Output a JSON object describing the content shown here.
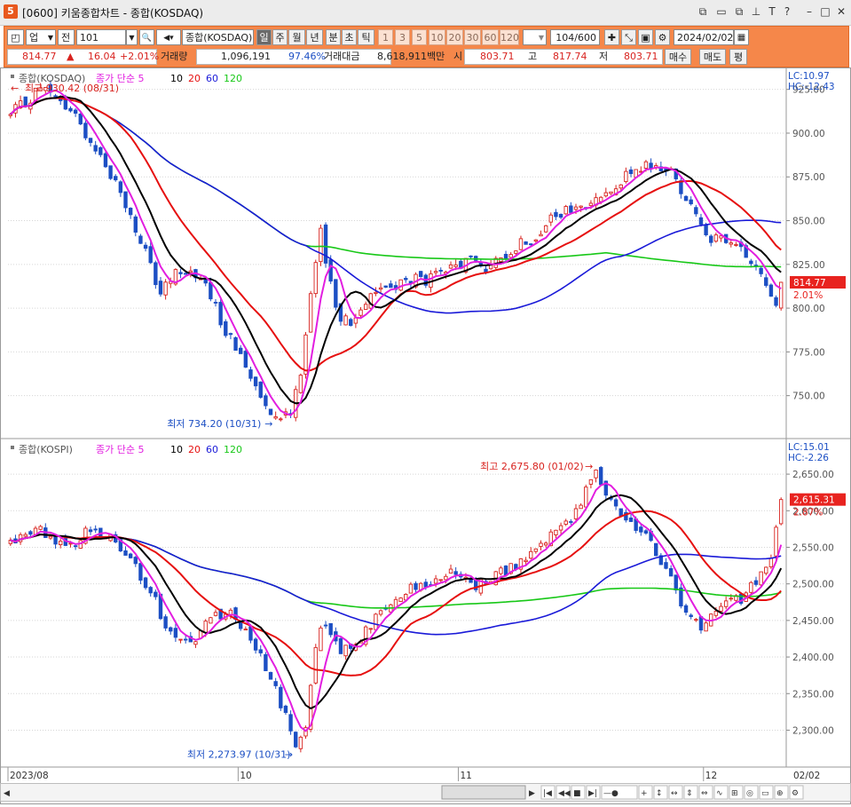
{
  "window": {
    "title": "[0600] 키움종합차트 - 종합(KOSDAQ)",
    "app_icon": "5"
  },
  "toolbar": {
    "market": "업",
    "prev": "전",
    "code": "101",
    "name": "종합(KOSDAQ)",
    "periods": [
      "일",
      "주",
      "월",
      "년",
      "분",
      "초",
      "틱"
    ],
    "active_period": "일",
    "intervals": [
      "1",
      "3",
      "5",
      "10",
      "20",
      "30",
      "60",
      "120"
    ],
    "count_current": "104",
    "count_total": "/600",
    "date": "2024/02/02"
  },
  "quote": {
    "price": "814.77",
    "change_arrow": "▲",
    "change": "16.04",
    "change_pct": "+2.01%",
    "volume_label": "거래량",
    "volume": "1,096,191",
    "volume_pct": "97.46%",
    "amount_label": "거래대금",
    "amount": "8,618,911백만",
    "open_label": "시",
    "open": "803.71",
    "high_label": "고",
    "high": "817.74",
    "low_label": "저",
    "low": "803.71",
    "buy_label": "매수",
    "sell_label": "매도",
    "eval_label": "평"
  },
  "colors": {
    "up": "#d8231f",
    "down": "#1c4fc4",
    "ma5": "#e21ee0",
    "ma10": "#000000",
    "ma20": "#e61010",
    "ma60": "#1a1ad8",
    "ma120": "#18c818"
  },
  "x_axis": {
    "labels": [
      "2023/08",
      "10",
      "11",
      "12",
      "2024/01",
      "02",
      "02/02"
    ]
  },
  "chart_data": [
    {
      "type": "candlestick",
      "name": "종합(KOSDAQ)",
      "legend": {
        "label": "종합(KOSDAQ)",
        "ma_title": "종가 단순",
        "periods": [
          "5",
          "10",
          "20",
          "60",
          "120"
        ]
      },
      "scale_info": {
        "lc": "LC:10.97",
        "hc": "HC:-12.43"
      },
      "yticks": [
        "925.00",
        "900.00",
        "875.00",
        "850.00",
        "825.00",
        "800.00",
        "775.00",
        "750.00"
      ],
      "ylim": [
        727,
        936
      ],
      "last_price": "814.77",
      "last_pct": "2.01%",
      "annotations": {
        "high": "최고 930.42 (08/31)",
        "low": "최저 734.20 (10/31)"
      },
      "start": 910,
      "end": 814.77,
      "anchors": [
        [
          0,
          910
        ],
        [
          6,
          926
        ],
        [
          12,
          913
        ],
        [
          17,
          892
        ],
        [
          22,
          866
        ],
        [
          26,
          838
        ],
        [
          30,
          808
        ],
        [
          34,
          823
        ],
        [
          38,
          818
        ],
        [
          42,
          793
        ],
        [
          46,
          772
        ],
        [
          50,
          752
        ],
        [
          53,
          738
        ],
        [
          56,
          742
        ],
        [
          58,
          765
        ],
        [
          60,
          808
        ],
        [
          62,
          842
        ],
        [
          64,
          812
        ],
        [
          66,
          796
        ],
        [
          68,
          790
        ],
        [
          72,
          810
        ],
        [
          76,
          812
        ],
        [
          80,
          816
        ],
        [
          84,
          816
        ],
        [
          88,
          822
        ],
        [
          92,
          828
        ],
        [
          96,
          822
        ],
        [
          100,
          834
        ],
        [
          104,
          840
        ],
        [
          108,
          850
        ],
        [
          112,
          856
        ],
        [
          116,
          858
        ],
        [
          120,
          870
        ],
        [
          124,
          876
        ],
        [
          128,
          882
        ],
        [
          132,
          878
        ],
        [
          136,
          858
        ],
        [
          140,
          840
        ],
        [
          144,
          836
        ],
        [
          148,
          828
        ],
        [
          151,
          812
        ],
        [
          153,
          805
        ],
        [
          154,
          815
        ]
      ]
    },
    {
      "type": "candlestick",
      "name": "종합(KOSPI)",
      "legend": {
        "label": "종합(KOSPI)",
        "ma_title": "종가 단순",
        "periods": [
          "5",
          "10",
          "20",
          "60",
          "120"
        ]
      },
      "scale_info": {
        "lc": "LC:15.01",
        "hc": "HC:-2.26"
      },
      "yticks": [
        "2,650.00",
        "2,600.00",
        "2,550.00",
        "2,500.00",
        "2,450.00",
        "2,400.00",
        "2,350.00",
        "2,300.00"
      ],
      "ylim": [
        2252,
        2695
      ],
      "last_price": "2,615.31",
      "last_pct": "2.87%",
      "annotations": {
        "high": "최고 2,675.80 (01/02)",
        "low": "최저 2,273.97 (10/31)"
      },
      "start": 2555,
      "end": 2615.31,
      "anchors": [
        [
          0,
          2555
        ],
        [
          6,
          2572
        ],
        [
          12,
          2548
        ],
        [
          16,
          2575
        ],
        [
          20,
          2565
        ],
        [
          24,
          2530
        ],
        [
          28,
          2490
        ],
        [
          32,
          2430
        ],
        [
          36,
          2420
        ],
        [
          40,
          2455
        ],
        [
          44,
          2460
        ],
        [
          48,
          2425
        ],
        [
          52,
          2375
        ],
        [
          55,
          2320
        ],
        [
          57,
          2280
        ],
        [
          59,
          2300
        ],
        [
          61,
          2420
        ],
        [
          63,
          2445
        ],
        [
          66,
          2410
        ],
        [
          69,
          2420
        ],
        [
          73,
          2455
        ],
        [
          77,
          2480
        ],
        [
          81,
          2500
        ],
        [
          85,
          2505
        ],
        [
          89,
          2515
        ],
        [
          93,
          2495
        ],
        [
          97,
          2510
        ],
        [
          101,
          2525
        ],
        [
          105,
          2545
        ],
        [
          109,
          2580
        ],
        [
          113,
          2595
        ],
        [
          117,
          2655
        ],
        [
          120,
          2610
        ],
        [
          124,
          2585
        ],
        [
          128,
          2555
        ],
        [
          132,
          2510
        ],
        [
          135,
          2455
        ],
        [
          138,
          2440
        ],
        [
          142,
          2470
        ],
        [
          146,
          2480
        ],
        [
          150,
          2510
        ],
        [
          152,
          2535
        ],
        [
          154,
          2615
        ]
      ]
    }
  ]
}
